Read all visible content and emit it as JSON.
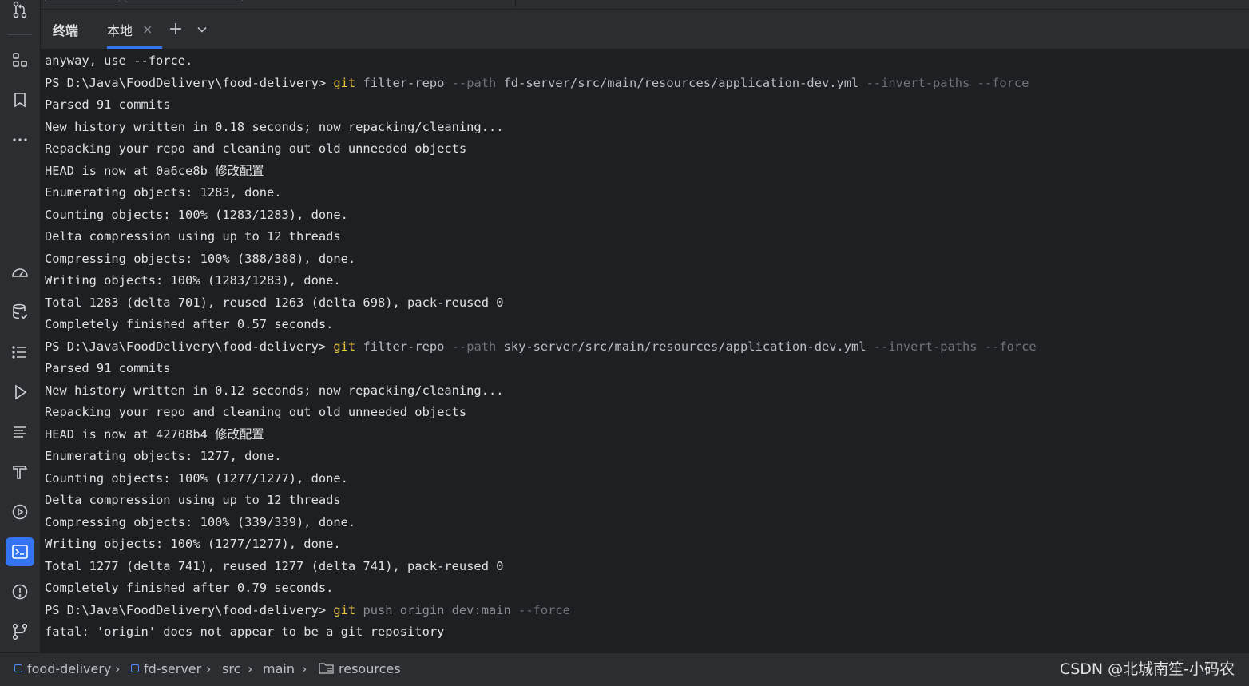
{
  "tabs": {
    "title": "终端",
    "local": "本地",
    "close_glyph": "×",
    "add_glyph": "+",
    "more_icon": "chevron-down-icon"
  },
  "terminal": {
    "lines": [
      {
        "segments": [
          {
            "t": "anyway, use --force.",
            "c": "plain"
          }
        ]
      },
      {
        "segments": [
          {
            "t": "PS D:\\Java\\FoodDelivery\\food-delivery> ",
            "c": "plain"
          },
          {
            "t": "git",
            "c": "cmd"
          },
          {
            "t": " filter-repo ",
            "c": "val"
          },
          {
            "t": "--path",
            "c": "flag"
          },
          {
            "t": " fd-server/src/main/resources/application-dev.yml ",
            "c": "val"
          },
          {
            "t": "--invert-paths --force",
            "c": "flag"
          }
        ]
      },
      {
        "segments": [
          {
            "t": "Parsed 91 commits",
            "c": "plain"
          }
        ]
      },
      {
        "segments": [
          {
            "t": "New history written in 0.18 seconds; now repacking/cleaning...",
            "c": "plain"
          }
        ]
      },
      {
        "segments": [
          {
            "t": "Repacking your repo and cleaning out old unneeded objects",
            "c": "plain"
          }
        ]
      },
      {
        "segments": [
          {
            "t": "HEAD is now at 0a6ce8b 修改配置",
            "c": "plain"
          }
        ]
      },
      {
        "segments": [
          {
            "t": "Enumerating objects: 1283, done.",
            "c": "plain"
          }
        ]
      },
      {
        "segments": [
          {
            "t": "Counting objects: 100% (1283/1283), done.",
            "c": "plain"
          }
        ]
      },
      {
        "segments": [
          {
            "t": "Delta compression using up to 12 threads",
            "c": "plain"
          }
        ]
      },
      {
        "segments": [
          {
            "t": "Compressing objects: 100% (388/388), done.",
            "c": "plain"
          }
        ]
      },
      {
        "segments": [
          {
            "t": "Writing objects: 100% (1283/1283), done.",
            "c": "plain"
          }
        ]
      },
      {
        "segments": [
          {
            "t": "Total 1283 (delta 701), reused 1263 (delta 698), pack-reused 0",
            "c": "plain"
          }
        ]
      },
      {
        "segments": [
          {
            "t": "Completely finished after 0.57 seconds.",
            "c": "plain"
          }
        ]
      },
      {
        "segments": [
          {
            "t": "PS D:\\Java\\FoodDelivery\\food-delivery> ",
            "c": "plain"
          },
          {
            "t": "git",
            "c": "cmd"
          },
          {
            "t": " filter-repo ",
            "c": "val"
          },
          {
            "t": "--path",
            "c": "flag"
          },
          {
            "t": " sky-server/src/main/resources/application-dev.yml ",
            "c": "val"
          },
          {
            "t": "--invert-paths --force",
            "c": "flag"
          }
        ]
      },
      {
        "segments": [
          {
            "t": "Parsed 91 commits",
            "c": "plain"
          }
        ]
      },
      {
        "segments": [
          {
            "t": "New history written in 0.12 seconds; now repacking/cleaning...",
            "c": "plain"
          }
        ]
      },
      {
        "segments": [
          {
            "t": "Repacking your repo and cleaning out old unneeded objects",
            "c": "plain"
          }
        ]
      },
      {
        "segments": [
          {
            "t": "HEAD is now at 42708b4 修改配置",
            "c": "plain"
          }
        ]
      },
      {
        "segments": [
          {
            "t": "Enumerating objects: 1277, done.",
            "c": "plain"
          }
        ]
      },
      {
        "segments": [
          {
            "t": "Counting objects: 100% (1277/1277), done.",
            "c": "plain"
          }
        ]
      },
      {
        "segments": [
          {
            "t": "Delta compression using up to 12 threads",
            "c": "plain"
          }
        ]
      },
      {
        "segments": [
          {
            "t": "Compressing objects: 100% (339/339), done.",
            "c": "plain"
          }
        ]
      },
      {
        "segments": [
          {
            "t": "Writing objects: 100% (1277/1277), done.",
            "c": "plain"
          }
        ]
      },
      {
        "segments": [
          {
            "t": "Total 1277 (delta 741), reused 1277 (delta 741), pack-reused 0",
            "c": "plain"
          }
        ]
      },
      {
        "segments": [
          {
            "t": "Completely finished after 0.79 seconds.",
            "c": "plain"
          }
        ]
      },
      {
        "segments": [
          {
            "t": "PS D:\\Java\\FoodDelivery\\food-delivery> ",
            "c": "plain"
          },
          {
            "t": "git",
            "c": "cmd"
          },
          {
            "t": " push origin dev:main ",
            "c": "arg"
          },
          {
            "t": "--force",
            "c": "flag"
          }
        ]
      },
      {
        "segments": [
          {
            "t": "fatal: 'origin' does not appear to be a git repository",
            "c": "plain"
          }
        ]
      }
    ]
  },
  "breadcrumb": {
    "items": [
      "food-delivery",
      "fd-server",
      "src",
      "main",
      "resources"
    ],
    "separator": "›"
  },
  "watermark": "CSDN @北城南笙-小码农",
  "sidebar": {
    "icons": [
      "commit-icon",
      "structure-icon",
      "bookmark-icon",
      "more-icon",
      "profiler-icon",
      "database-icon",
      "todo-list-icon",
      "run-icon",
      "log-icon",
      "build-icon",
      "services-icon",
      "terminal-icon",
      "problems-icon",
      "git-branch-icon"
    ],
    "active": "terminal-icon"
  },
  "colors": {
    "background": "#1e1f22",
    "panel": "#2b2d30",
    "accent": "#3574f0",
    "command": "#e8c63c"
  }
}
